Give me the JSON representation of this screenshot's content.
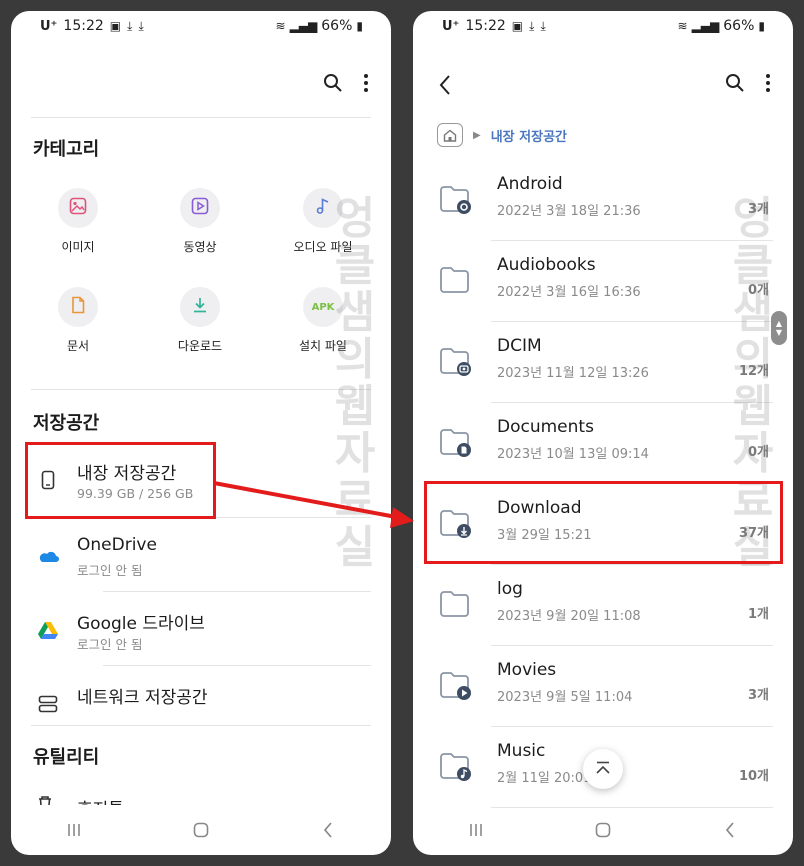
{
  "status_bar": {
    "carrier": "U⁺",
    "time": "15:22",
    "battery": "66%"
  },
  "left": {
    "categories_title": "카테고리",
    "categories": [
      {
        "label": "이미지",
        "icon": "image-icon",
        "color": "#e0527a"
      },
      {
        "label": "동영상",
        "icon": "video-icon",
        "color": "#8a5bd6"
      },
      {
        "label": "오디오 파일",
        "icon": "music-icon",
        "color": "#5a7bd6"
      },
      {
        "label": "문서",
        "icon": "document-icon",
        "color": "#e8963a"
      },
      {
        "label": "다운로드",
        "icon": "download-icon",
        "color": "#2fb59a"
      },
      {
        "label": "설치 파일",
        "icon": "apk-icon",
        "text": "APK",
        "color": "#7bc043"
      }
    ],
    "storage_title": "저장공간",
    "storage": [
      {
        "title": "내장 저장공간",
        "sub": "99.39 GB / 256 GB",
        "icon": "phone-icon"
      },
      {
        "title": "OneDrive",
        "sub": "로그인 안 됨",
        "icon": "onedrive-icon"
      },
      {
        "title": "Google 드라이브",
        "sub": "로그인 안 됨",
        "icon": "google-drive-icon"
      },
      {
        "title": "네트워크 저장공간",
        "sub": "",
        "icon": "network-storage-icon"
      }
    ],
    "utility_title": "유틸리티",
    "utility_partial": "휴지통"
  },
  "right": {
    "breadcrumb": "내장 저장공간",
    "files": [
      {
        "name": "Android",
        "date": "2022년 3월 18일 21:36",
        "count": "3개",
        "badge": "gear"
      },
      {
        "name": "Audiobooks",
        "date": "2022년 3월 16일 16:36",
        "count": "0개",
        "badge": ""
      },
      {
        "name": "DCIM",
        "date": "2023년 11월 12일 13:26",
        "count": "12개",
        "badge": "camera"
      },
      {
        "name": "Documents",
        "date": "2023년 10월 13일 09:14",
        "count": "0개",
        "badge": "doc"
      },
      {
        "name": "Download",
        "date": "3월 29일 15:21",
        "count": "37개",
        "badge": "download"
      },
      {
        "name": "log",
        "date": "2023년 9월 20일 11:08",
        "count": "1개",
        "badge": ""
      },
      {
        "name": "Movies",
        "date": "2023년 9월 5일 11:04",
        "count": "3개",
        "badge": "play"
      },
      {
        "name": "Music",
        "date": "2월 11일 20:01",
        "count": "10개",
        "badge": "note"
      }
    ]
  },
  "watermark": "엉클샘의웹자료실",
  "colors": {
    "highlight": "#e41b1b",
    "folder_stroke": "#8a95a5",
    "badge_fill": "#3e4d63",
    "accent": "#4a76c0"
  }
}
